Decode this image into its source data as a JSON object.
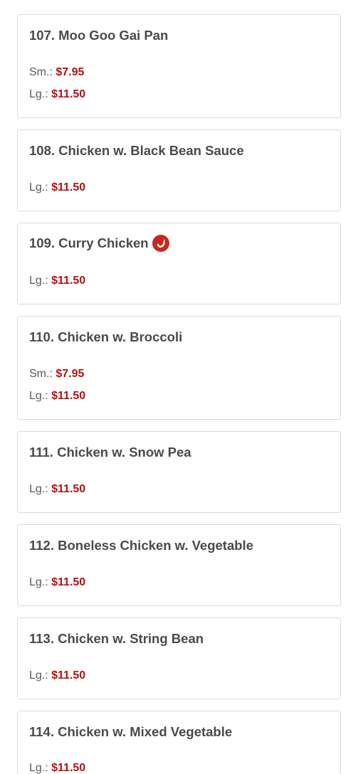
{
  "menu": {
    "items": [
      {
        "title": "107. Moo Goo Gai Pan",
        "spicy": false,
        "prices": [
          {
            "label": "Sm.:",
            "value": "$7.95"
          },
          {
            "label": "Lg.:",
            "value": "$11.50"
          }
        ]
      },
      {
        "title": "108. Chicken w. Black Bean Sauce",
        "spicy": false,
        "prices": [
          {
            "label": "Lg.:",
            "value": "$11.50"
          }
        ]
      },
      {
        "title": "109. Curry Chicken",
        "spicy": true,
        "icon": "chili-pepper-icon",
        "prices": [
          {
            "label": "Lg.:",
            "value": "$11.50"
          }
        ]
      },
      {
        "title": "110. Chicken w. Broccoli",
        "spicy": false,
        "prices": [
          {
            "label": "Sm.:",
            "value": "$7.95"
          },
          {
            "label": "Lg.:",
            "value": "$11.50"
          }
        ]
      },
      {
        "title": "111. Chicken w. Snow Pea",
        "spicy": false,
        "prices": [
          {
            "label": "Lg.:",
            "value": "$11.50"
          }
        ]
      },
      {
        "title": "112. Boneless Chicken w. Vegetable",
        "spicy": false,
        "prices": [
          {
            "label": "Lg.:",
            "value": "$11.50"
          }
        ]
      },
      {
        "title": "113. Chicken w. String Bean",
        "spicy": false,
        "prices": [
          {
            "label": "Lg.:",
            "value": "$11.50"
          }
        ]
      },
      {
        "title": "114. Chicken w. Mixed Vegetable",
        "spicy": false,
        "prices": [
          {
            "label": "Lg.:",
            "value": "$11.50"
          }
        ]
      }
    ]
  },
  "colors": {
    "price": "#b8100f",
    "spicy_icon": "#c8281e",
    "border": "#dcdcdc",
    "text": "#4a4a4a"
  }
}
